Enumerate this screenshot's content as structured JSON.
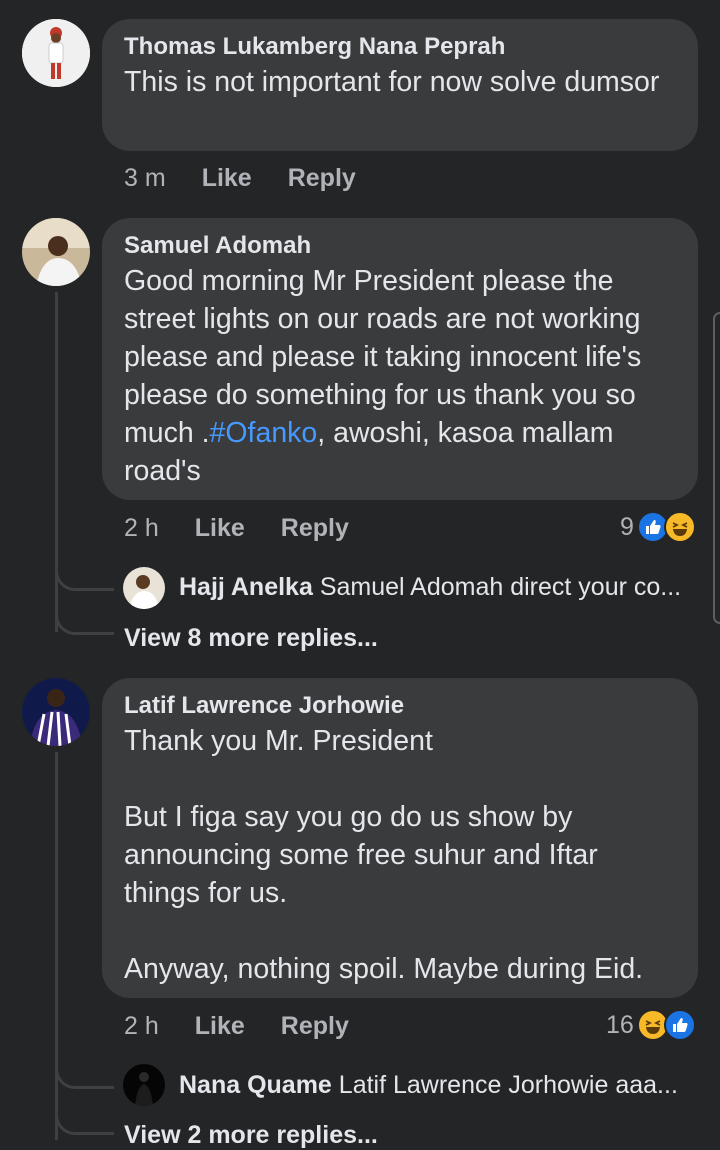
{
  "comments": [
    {
      "author": "Thomas Lukamberg Nana Peprah",
      "text": "This is not important for now solve dumsor",
      "time": "3 m",
      "like_label": "Like",
      "reply_label": "Reply"
    },
    {
      "author": "Samuel Adomah",
      "text_before": "Good morning Mr President please the street lights on our roads are not working please and please it taking innocent life's please do something for us thank you so much .",
      "hashtag": "#Ofanko",
      "text_after": ", awoshi, kasoa mallam road's",
      "time": "2 h",
      "like_label": "Like",
      "reply_label": "Reply",
      "reaction_count": "9",
      "reply_preview": {
        "author": "Hajj Anelka",
        "text": "Samuel Adomah  direct your co..."
      },
      "view_more": "View 8 more replies..."
    },
    {
      "author": "Latif Lawrence Jorhowie",
      "text": "Thank you Mr. President\n\nBut I figa say you go do us show by announcing some free suhur and Iftar things for us.\n\nAnyway, nothing spoil. Maybe during Eid.",
      "time": "2 h",
      "like_label": "Like",
      "reply_label": "Reply",
      "reaction_count": "16",
      "reply_preview": {
        "author": "Nana Quame",
        "text": "Latif Lawrence Jorhowie  aaa..."
      },
      "view_more": "View 2 more replies..."
    }
  ],
  "colors": {
    "background": "#242526",
    "bubble": "#3a3b3c",
    "link": "#4599ff",
    "like": "#1b74e4",
    "haha": "#f7b928"
  }
}
